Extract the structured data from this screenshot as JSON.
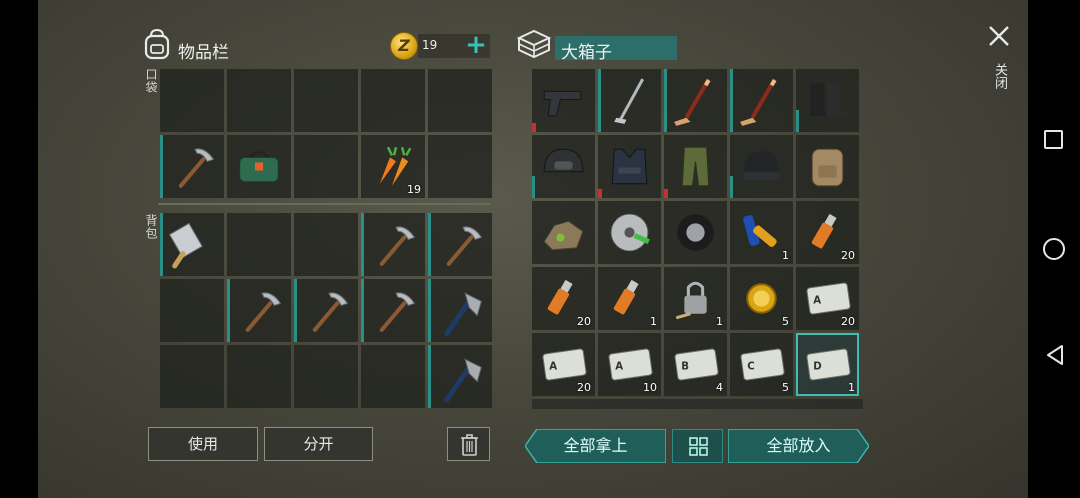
{
  "inventory": {
    "title": "物品栏",
    "coins": "19",
    "coin_symbol": "Z",
    "pocket_label": "口袋",
    "backpack_label": "背包",
    "pocket_slots": [
      {
        "item": "",
        "qty": ""
      },
      {
        "item": "",
        "qty": ""
      },
      {
        "item": "",
        "qty": ""
      },
      {
        "item": "",
        "qty": ""
      },
      {
        "item": "",
        "qty": ""
      },
      {
        "item": "pickaxe-icon",
        "qty": ""
      },
      {
        "item": "first-aid-bag-icon",
        "qty": ""
      },
      {
        "item": "",
        "qty": ""
      },
      {
        "item": "carrots-icon",
        "qty": "19"
      },
      {
        "item": "",
        "qty": ""
      }
    ],
    "backpack_slots": [
      {
        "item": "cleaver-icon",
        "qty": ""
      },
      {
        "item": "",
        "qty": ""
      },
      {
        "item": "",
        "qty": ""
      },
      {
        "item": "pickaxe-icon",
        "qty": ""
      },
      {
        "item": "pickaxe-icon",
        "qty": ""
      },
      {
        "item": "",
        "qty": ""
      },
      {
        "item": "pickaxe-icon",
        "qty": ""
      },
      {
        "item": "pickaxe-icon",
        "qty": ""
      },
      {
        "item": "pickaxe-icon",
        "qty": ""
      },
      {
        "item": "hatchet-icon",
        "qty": ""
      },
      {
        "item": "",
        "qty": ""
      },
      {
        "item": "",
        "qty": ""
      },
      {
        "item": "",
        "qty": ""
      },
      {
        "item": "",
        "qty": ""
      },
      {
        "item": "hatchet-icon",
        "qty": ""
      }
    ],
    "use_label": "使用",
    "split_label": "分开"
  },
  "container": {
    "title": "大箱子",
    "slots": [
      {
        "item": "pistol-icon",
        "qty": ""
      },
      {
        "item": "golf-club-icon",
        "qty": ""
      },
      {
        "item": "hockey-stick-icon",
        "qty": ""
      },
      {
        "item": "hockey-stick-icon",
        "qty": ""
      },
      {
        "item": "boots-icon",
        "qty": ""
      },
      {
        "item": "helmet-icon",
        "qty": ""
      },
      {
        "item": "tactical-vest-icon",
        "qty": ""
      },
      {
        "item": "camo-pants-icon",
        "qty": ""
      },
      {
        "item": "beanie-icon",
        "qty": ""
      },
      {
        "item": "backpack-icon",
        "qty": ""
      },
      {
        "item": "ore-icon",
        "qty": ""
      },
      {
        "item": "saw-blade-icon",
        "qty": ""
      },
      {
        "item": "tire-icon",
        "qty": ""
      },
      {
        "item": "batteries-icon",
        "qty": "1"
      },
      {
        "item": "usb-stick-icon",
        "qty": "20"
      },
      {
        "item": "usb-stick-icon",
        "qty": "20"
      },
      {
        "item": "usb-stick-icon",
        "qty": "1"
      },
      {
        "item": "padlock-key-icon",
        "qty": "1"
      },
      {
        "item": "gold-watch-icon",
        "qty": "5"
      },
      {
        "item": "army-card-a-icon",
        "qty": "20"
      },
      {
        "item": "army-card-a-icon",
        "qty": "20"
      },
      {
        "item": "army-card-a-icon",
        "qty": "10"
      },
      {
        "item": "army-card-b-icon",
        "qty": "4"
      },
      {
        "item": "army-card-c-icon",
        "qty": "5"
      },
      {
        "item": "army-card-d-icon",
        "qty": "1"
      }
    ],
    "take_all_label": "全部拿上",
    "put_all_label": "全部放入"
  },
  "close_label": "关闭",
  "colors": {
    "accent": "#39c2b3",
    "teal_button": "#1f5e59",
    "durability": "#2a8f86",
    "damage": "#c53131"
  }
}
